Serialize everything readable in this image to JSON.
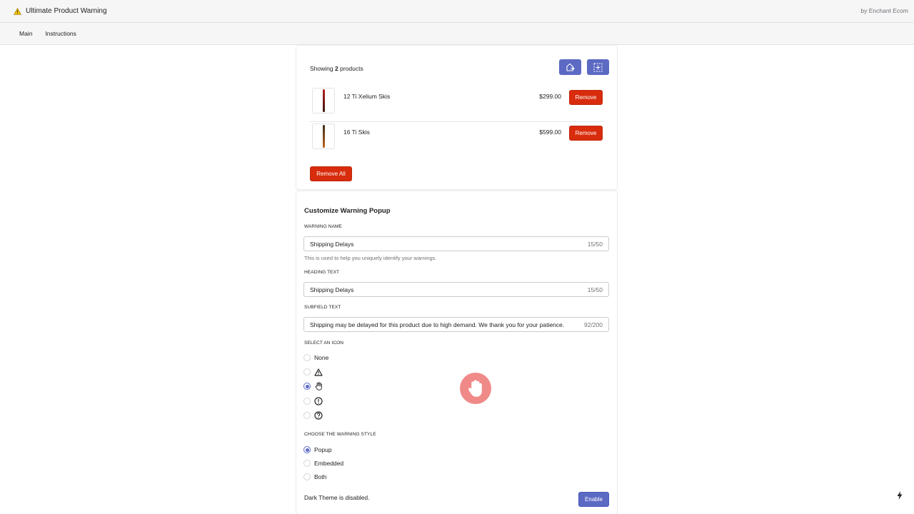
{
  "header": {
    "app_title": "Ultimate Product Warning",
    "byline": "by Enchant Ecom",
    "app_icon": "warning-icon"
  },
  "nav": {
    "items": [
      {
        "label": "Main"
      },
      {
        "label": "Instructions"
      }
    ]
  },
  "products": {
    "showing_prefix": "Showing",
    "showing_count": "2",
    "showing_suffix": "products",
    "toolbar_icons": [
      "export-icon",
      "select-add-icon"
    ],
    "items": [
      {
        "name": "12 Ti Xelium Skis",
        "price": "$299.00",
        "remove_label": "Remove",
        "color_top": "#b81f1f",
        "color_bottom": "#3a1a12"
      },
      {
        "name": "16 Ti Skis",
        "price": "$599.00",
        "remove_label": "Remove",
        "color_top": "#3b2a1a",
        "color_bottom": "#c0661e"
      }
    ],
    "remove_all_label": "Remove All"
  },
  "customize": {
    "title": "Customize Warning Popup",
    "warning_name": {
      "label": "WARNING NAME",
      "value": "Shipping Delays",
      "count": "15/50",
      "help": "This is used to help you uniquely identify your warnings."
    },
    "heading_text": {
      "label": "HEADING TEXT",
      "value": "Shipping Delays",
      "count": "15/50"
    },
    "subfield_text": {
      "label": "SUBFIELD TEXT",
      "value": "Shipping may be delayed for this product due to high demand. We thank you for your patience.",
      "count": "92/200"
    },
    "icon_select": {
      "label": "SELECT AN ICON",
      "none_label": "None",
      "options": [
        "none",
        "warning-triangle-icon",
        "hand-stop-icon",
        "info-circle-icon",
        "question-circle-icon"
      ],
      "selected": "hand-stop-icon"
    },
    "style_select": {
      "label": "CHOOSE THE WARNING STYLE",
      "options": [
        {
          "label": "Popup",
          "checked": true
        },
        {
          "label": "Embedded",
          "checked": false
        },
        {
          "label": "Both",
          "checked": false
        }
      ]
    },
    "dark_theme_text": "Dark Theme is disabled.",
    "enable_label": "Enable",
    "preview_icon": "hand-stop-icon"
  },
  "colors": {
    "primary": "#5c6ac4",
    "critical": "#d82c0d",
    "preview_bg": "#f08a88"
  },
  "footer_icon": "lightning-bolt-icon"
}
